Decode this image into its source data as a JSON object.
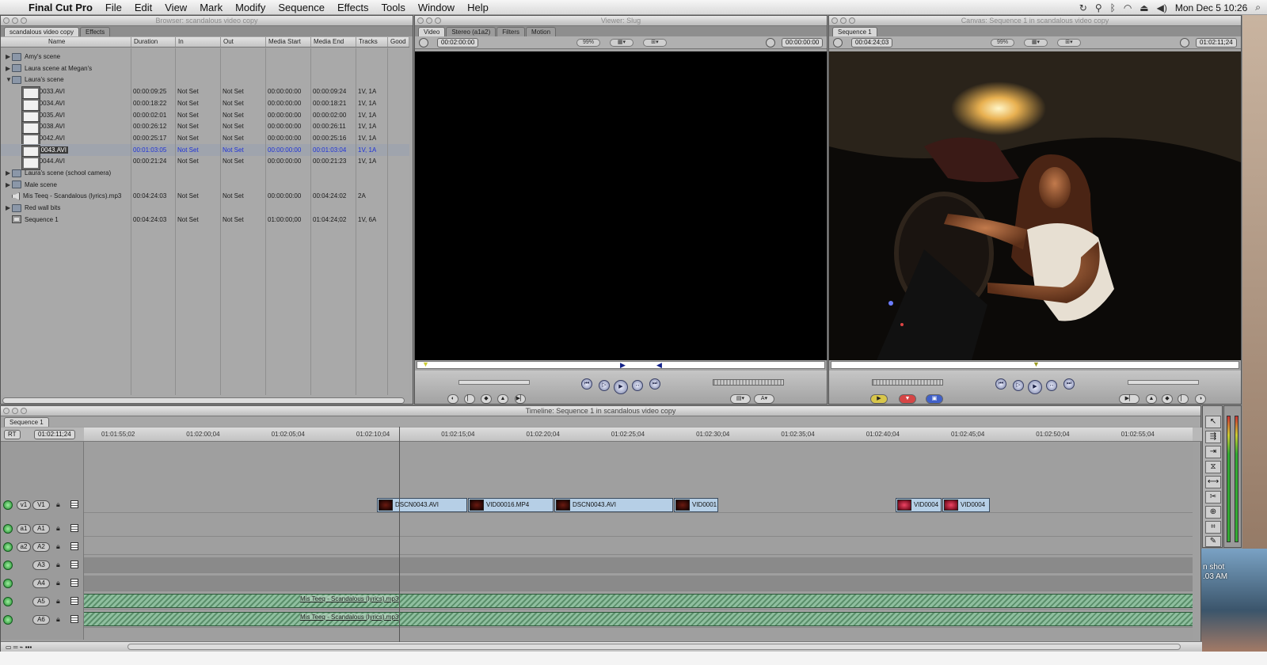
{
  "menubar": {
    "app": "Final Cut Pro",
    "items": [
      "File",
      "Edit",
      "View",
      "Mark",
      "Modify",
      "Sequence",
      "Effects",
      "Tools",
      "Window",
      "Help"
    ],
    "clock": "Mon Dec 5  10:26"
  },
  "browser": {
    "title": "Browser: scandalous video copy",
    "tabs": [
      "scandalous video copy",
      "Effects"
    ],
    "columns": [
      "Name",
      "Duration",
      "In",
      "Out",
      "Media Start",
      "Media End",
      "Tracks",
      "Good"
    ],
    "rows": [
      {
        "name": "Amy's scene",
        "kind": "folder",
        "expand": "closed"
      },
      {
        "name": "Laura scene at Megan's",
        "kind": "folder",
        "expand": "closed"
      },
      {
        "name": "Laura's scene",
        "kind": "folder",
        "expand": "open"
      },
      {
        "name": "DSCN0033.AVI",
        "kind": "clip",
        "duration": "00:00:09:25",
        "in": "Not Set",
        "out": "Not Set",
        "mstart": "00:00:00:00",
        "mend": "00:00:09:24",
        "tracks": "1V, 1A"
      },
      {
        "name": "DSCN0034.AVI",
        "kind": "clip",
        "duration": "00:00:18:22",
        "in": "Not Set",
        "out": "Not Set",
        "mstart": "00:00:00:00",
        "mend": "00:00:18:21",
        "tracks": "1V, 1A"
      },
      {
        "name": "DSCN0035.AVI",
        "kind": "clip",
        "duration": "00:00:02:01",
        "in": "Not Set",
        "out": "Not Set",
        "mstart": "00:00:00:00",
        "mend": "00:00:02:00",
        "tracks": "1V, 1A"
      },
      {
        "name": "DSCN0038.AVI",
        "kind": "clip",
        "duration": "00:00:26:12",
        "in": "Not Set",
        "out": "Not Set",
        "mstart": "00:00:00:00",
        "mend": "00:00:26:11",
        "tracks": "1V, 1A"
      },
      {
        "name": "DSCN0042.AVI",
        "kind": "clip",
        "duration": "00:00:25:17",
        "in": "Not Set",
        "out": "Not Set",
        "mstart": "00:00:00:00",
        "mend": "00:00:25:16",
        "tracks": "1V, 1A"
      },
      {
        "name": "DSCN0043.AVI",
        "kind": "clip",
        "selected": true,
        "duration": "00:01:03:05",
        "in": "Not Set",
        "out": "Not Set",
        "mstart": "00:00:00:00",
        "mend": "00:01:03:04",
        "tracks": "1V, 1A"
      },
      {
        "name": "DSCN0044.AVI",
        "kind": "clip",
        "duration": "00:00:21:24",
        "in": "Not Set",
        "out": "Not Set",
        "mstart": "00:00:00:00",
        "mend": "00:00:21:23",
        "tracks": "1V, 1A"
      },
      {
        "name": "Laura's scene (school camera)",
        "kind": "folder",
        "expand": "closed"
      },
      {
        "name": "Male scene",
        "kind": "folder",
        "expand": "closed"
      },
      {
        "name": "Mis Teeq - Scandalous (lyrics).mp3",
        "kind": "audio",
        "duration": "00:04:24:03",
        "in": "Not Set",
        "out": "Not Set",
        "mstart": "00:00:00:00",
        "mend": "00:04:24:02",
        "tracks": "2A"
      },
      {
        "name": "Red wall bits",
        "kind": "folder",
        "expand": "closed"
      },
      {
        "name": "Sequence 1",
        "kind": "seq",
        "duration": "00:04:24:03",
        "in": "Not Set",
        "out": "Not Set",
        "mstart": "01:00:00;00",
        "mend": "01:04:24;02",
        "tracks": "1V, 6A"
      }
    ]
  },
  "viewer": {
    "title": "Viewer: Slug",
    "tabs": [
      "Video",
      "Stereo (a1a2)",
      "Filters",
      "Motion"
    ],
    "duration": "00:02:00:00",
    "zoom": "99%",
    "timecode": "00:00:00:00"
  },
  "canvas": {
    "title": "Canvas: Sequence 1 in scandalous video copy",
    "tabs": [
      "Sequence 1"
    ],
    "duration": "00:04:24;03",
    "zoom": "99%",
    "timecode": "01:02:11;24"
  },
  "timeline": {
    "title": "Timeline: Sequence 1 in scandalous video copy",
    "tab": "Sequence 1",
    "rt": "RT",
    "timecode": "01:02:11;24",
    "ruler": [
      "01:01:55;02",
      "01:02:00;04",
      "01:02:05;04",
      "01:02:10;04",
      "01:02:15;04",
      "01:02:20;04",
      "01:02:25;04",
      "01:02:30;04",
      "01:02:35;04",
      "01:02:40;04",
      "01:02:45;04",
      "01:02:50;04",
      "01:02:55;04"
    ],
    "tracks": [
      {
        "src": "v1",
        "dst": "V1"
      },
      {
        "src": "a1",
        "dst": "A1"
      },
      {
        "src": "a2",
        "dst": "A2"
      },
      {
        "src": "",
        "dst": "A3"
      },
      {
        "src": "",
        "dst": "A4"
      },
      {
        "src": "",
        "dst": "A5"
      },
      {
        "src": "",
        "dst": "A6"
      }
    ],
    "video_clips": [
      {
        "name": "DSCN0043.AVI"
      },
      {
        "name": "VID00016.MP4"
      },
      {
        "name": "DSCN0043.AVI"
      },
      {
        "name": "VID0001"
      },
      {
        "name": "VID0004"
      },
      {
        "name": "VID0004"
      }
    ],
    "audio_clip": "Mis Teeq - Scandalous (lyrics).mp3"
  },
  "desktop": {
    "screenshot_label_1": "n shot",
    "screenshot_label_2": ".03 AM"
  }
}
